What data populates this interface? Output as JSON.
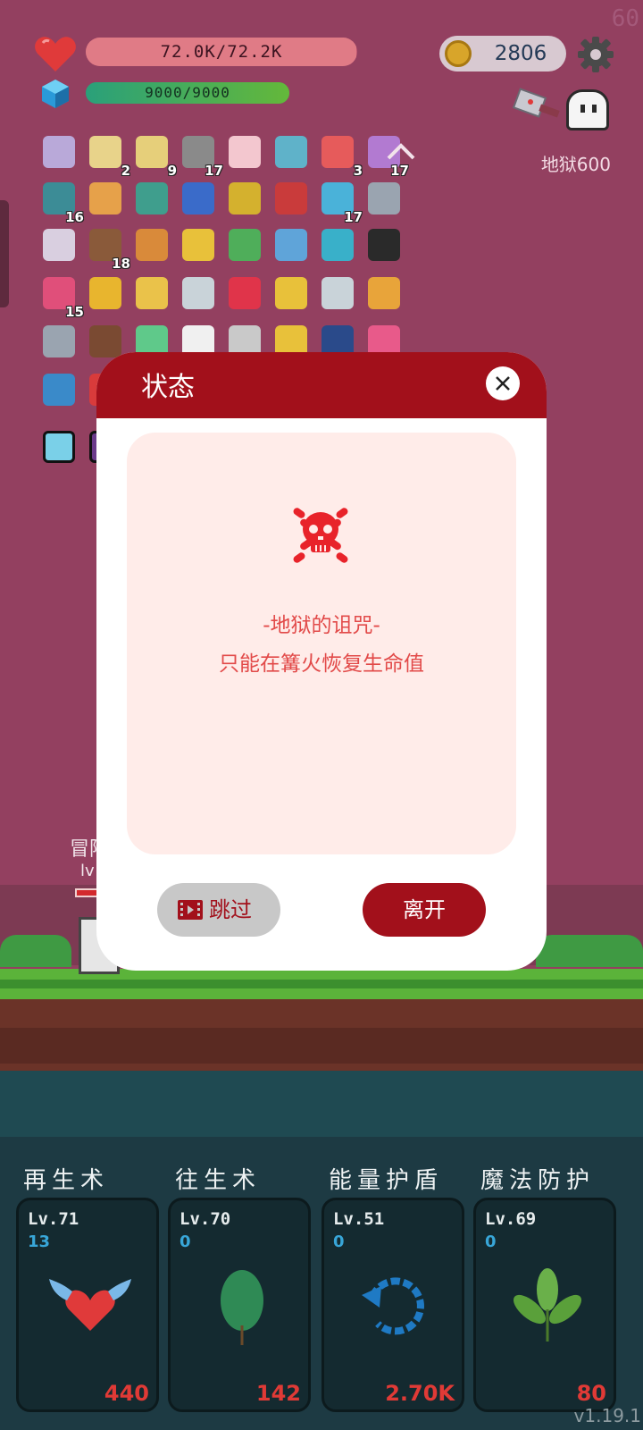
{
  "hud": {
    "fps": "60",
    "hp_text": "72.0K/72.2K",
    "hp_fraction": 0.997,
    "mp_text": "9000/9000",
    "mp_fraction": 1.0,
    "coins": "2806",
    "stage": "地狱600"
  },
  "inventory": [
    {
      "icon": "scroll-icon",
      "color": "#b9a9d9",
      "count": ""
    },
    {
      "icon": "notebook-icon",
      "color": "#e8d38a",
      "count": "2"
    },
    {
      "icon": "map-icon",
      "color": "#e6cf7a",
      "count": "9"
    },
    {
      "icon": "spiked-ball-icon",
      "color": "#8a8a8a",
      "count": "17"
    },
    {
      "icon": "calendar-icon",
      "color": "#f3c7cf",
      "count": ""
    },
    {
      "icon": "magnifier-icon",
      "color": "#5fb2c9",
      "count": ""
    },
    {
      "icon": "pill-icon",
      "color": "#e65b5b",
      "count": "3"
    },
    {
      "icon": "flower-pot-icon",
      "color": "#b27ad1",
      "count": "17"
    },
    {
      "icon": "ring-icon",
      "color": "#3c8c96",
      "count": "16"
    },
    {
      "icon": "cookbook-icon",
      "color": "#e6a14a",
      "count": ""
    },
    {
      "icon": "tent-icon",
      "color": "#3f9e8d",
      "count": ""
    },
    {
      "icon": "star-card-icon",
      "color": "#3a6bc9",
      "count": ""
    },
    {
      "icon": "egg-icon",
      "color": "#d4b12e",
      "count": ""
    },
    {
      "icon": "shield-icon",
      "color": "#c93b3b",
      "count": ""
    },
    {
      "icon": "potion-icon",
      "color": "#4ab2d9",
      "count": "17"
    },
    {
      "icon": "crossed-swords-icon",
      "color": "#9aa4b0",
      "count": ""
    },
    {
      "icon": "molecule-icon",
      "color": "#d9cfe0",
      "count": ""
    },
    {
      "icon": "flag-mound-icon",
      "color": "#8a5a3a",
      "count": "18"
    },
    {
      "icon": "briefcase-icon",
      "color": "#d98a3a",
      "count": ""
    },
    {
      "icon": "crown-icon",
      "color": "#e8c13a",
      "count": ""
    },
    {
      "icon": "money-icon",
      "color": "#4fae5a",
      "count": ""
    },
    {
      "icon": "robe-icon",
      "color": "#5fa4d9",
      "count": ""
    },
    {
      "icon": "spiral-icon",
      "color": "#39b0c9",
      "count": ""
    },
    {
      "icon": "cauldron-icon",
      "color": "#2a2a2a",
      "count": ""
    },
    {
      "icon": "jam-jar-icon",
      "color": "#e04f7a",
      "count": "15"
    },
    {
      "icon": "pineapple-icon",
      "color": "#e8b52e",
      "count": ""
    },
    {
      "icon": "beer-icon",
      "color": "#eac24a",
      "count": ""
    },
    {
      "icon": "bulb-icon",
      "color": "#c9d3d9",
      "count": ""
    },
    {
      "icon": "ruby-icon",
      "color": "#e0344a",
      "count": ""
    },
    {
      "icon": "magic-wand-icon",
      "color": "#e8c13a",
      "count": ""
    },
    {
      "icon": "hook-icon",
      "color": "#c9d3d9",
      "count": ""
    },
    {
      "icon": "crown-jewel-icon",
      "color": "#e8a43a",
      "count": ""
    },
    {
      "icon": "pin-icon",
      "color": "#9aa4b0",
      "count": ""
    },
    {
      "icon": "mushroom-icon",
      "color": "#7a4a32",
      "count": ""
    },
    {
      "icon": "gourd-icon",
      "color": "#5fc98a",
      "count": ""
    },
    {
      "icon": "ghost-icon",
      "color": "#f0f0f0",
      "count": ""
    },
    {
      "icon": "crescent-icon",
      "color": "#c9c9c9",
      "count": ""
    },
    {
      "icon": "sun-icon",
      "color": "#e8c13a",
      "count": ""
    },
    {
      "icon": "bible-icon",
      "color": "#2a4a8a",
      "count": ""
    },
    {
      "icon": "bubbles-icon",
      "color": "#e85a8a",
      "count": ""
    },
    {
      "icon": "scroll-blue-icon",
      "color": "#3a8ac9",
      "count": ""
    },
    {
      "icon": "gift-icon",
      "color": "#d93b3b",
      "count": ""
    },
    {
      "icon": "framed-ice-icon",
      "color": "#7ad0e8",
      "count": ""
    },
    {
      "icon": "framed-void-icon",
      "color": "#6a3a8a",
      "count": ""
    }
  ],
  "hero": {
    "name": "冒险",
    "level": "lv"
  },
  "modal": {
    "title": "状态",
    "curse_title": "-地狱的诅咒-",
    "curse_desc": "只能在篝火恢复生命值",
    "skip_label": "跳过",
    "leave_label": "离开"
  },
  "skills": [
    {
      "title": "再生术",
      "level": "Lv.71",
      "count": "13",
      "cost": "440",
      "icon": "winged-heart-icon"
    },
    {
      "title": "往生术",
      "level": "Lv.70",
      "count": "0",
      "cost": "142",
      "icon": "leaf-icon"
    },
    {
      "title": "能量护盾",
      "level": "Lv.51",
      "count": "0",
      "cost": "2.70K",
      "icon": "refresh-arrow-icon"
    },
    {
      "title": "魔法防护",
      "level": "Lv.69",
      "count": "0",
      "cost": "80",
      "icon": "herb-icon"
    }
  ],
  "version": "v1.19.1",
  "colors": {
    "modal_red": "#a2101b",
    "curse_text": "#e24a49",
    "background": "#934060"
  }
}
